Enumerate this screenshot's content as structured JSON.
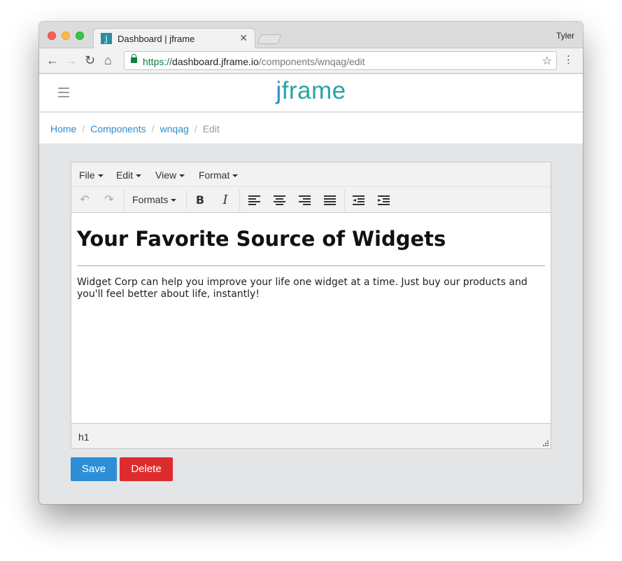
{
  "browser": {
    "tab_title": "Dashboard | jframe",
    "tab_favicon": "j",
    "profile_name": "Tyler",
    "url_protocol": "https://",
    "url_host": "dashboard.jframe.io",
    "url_path": "/components/wnqag/edit"
  },
  "app": {
    "logo": {
      "first": "j",
      "rest": "frame"
    },
    "breadcrumb": [
      "Home",
      "Components",
      "wnqag",
      "Edit"
    ]
  },
  "editor": {
    "menus": [
      "File",
      "Edit",
      "View",
      "Format"
    ],
    "formats_label": "Formats",
    "bold_label": "B",
    "italic_label": "I",
    "heading": "Your Favorite Source of Widgets",
    "paragraph": "Widget Corp can help you improve your life one widget at a time. Just buy our products and you'll feel better about life, instantly!",
    "status_path": "h1"
  },
  "actions": {
    "save": "Save",
    "delete": "Delete"
  },
  "colors": {
    "save": "#2d8ed6",
    "delete": "#de2c2c",
    "link": "#2a8bd0",
    "logo": "#2ba3a2"
  }
}
